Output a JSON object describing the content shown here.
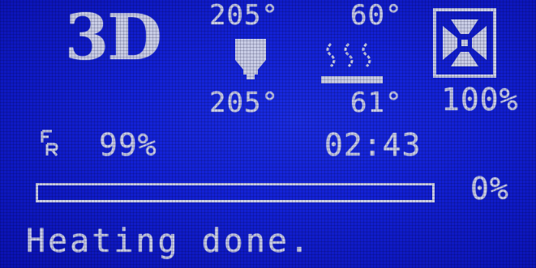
{
  "logo": "3D",
  "hotend": {
    "target": "205°",
    "current": "205°",
    "icon": "hotend-nozzle-icon"
  },
  "bed": {
    "target": "60°",
    "current": "61°",
    "icon": "heated-bed-icon"
  },
  "fan": {
    "speed": "100%",
    "icon": "fan-icon"
  },
  "feedrate": {
    "icon": "feedrate-icon",
    "value": "99%"
  },
  "elapsed_time": "02:43",
  "progress": {
    "value": 0,
    "label": "0%"
  },
  "status_message": "Heating done.",
  "colors": {
    "background": "#1322d6",
    "pixels": "#c9cde6"
  }
}
